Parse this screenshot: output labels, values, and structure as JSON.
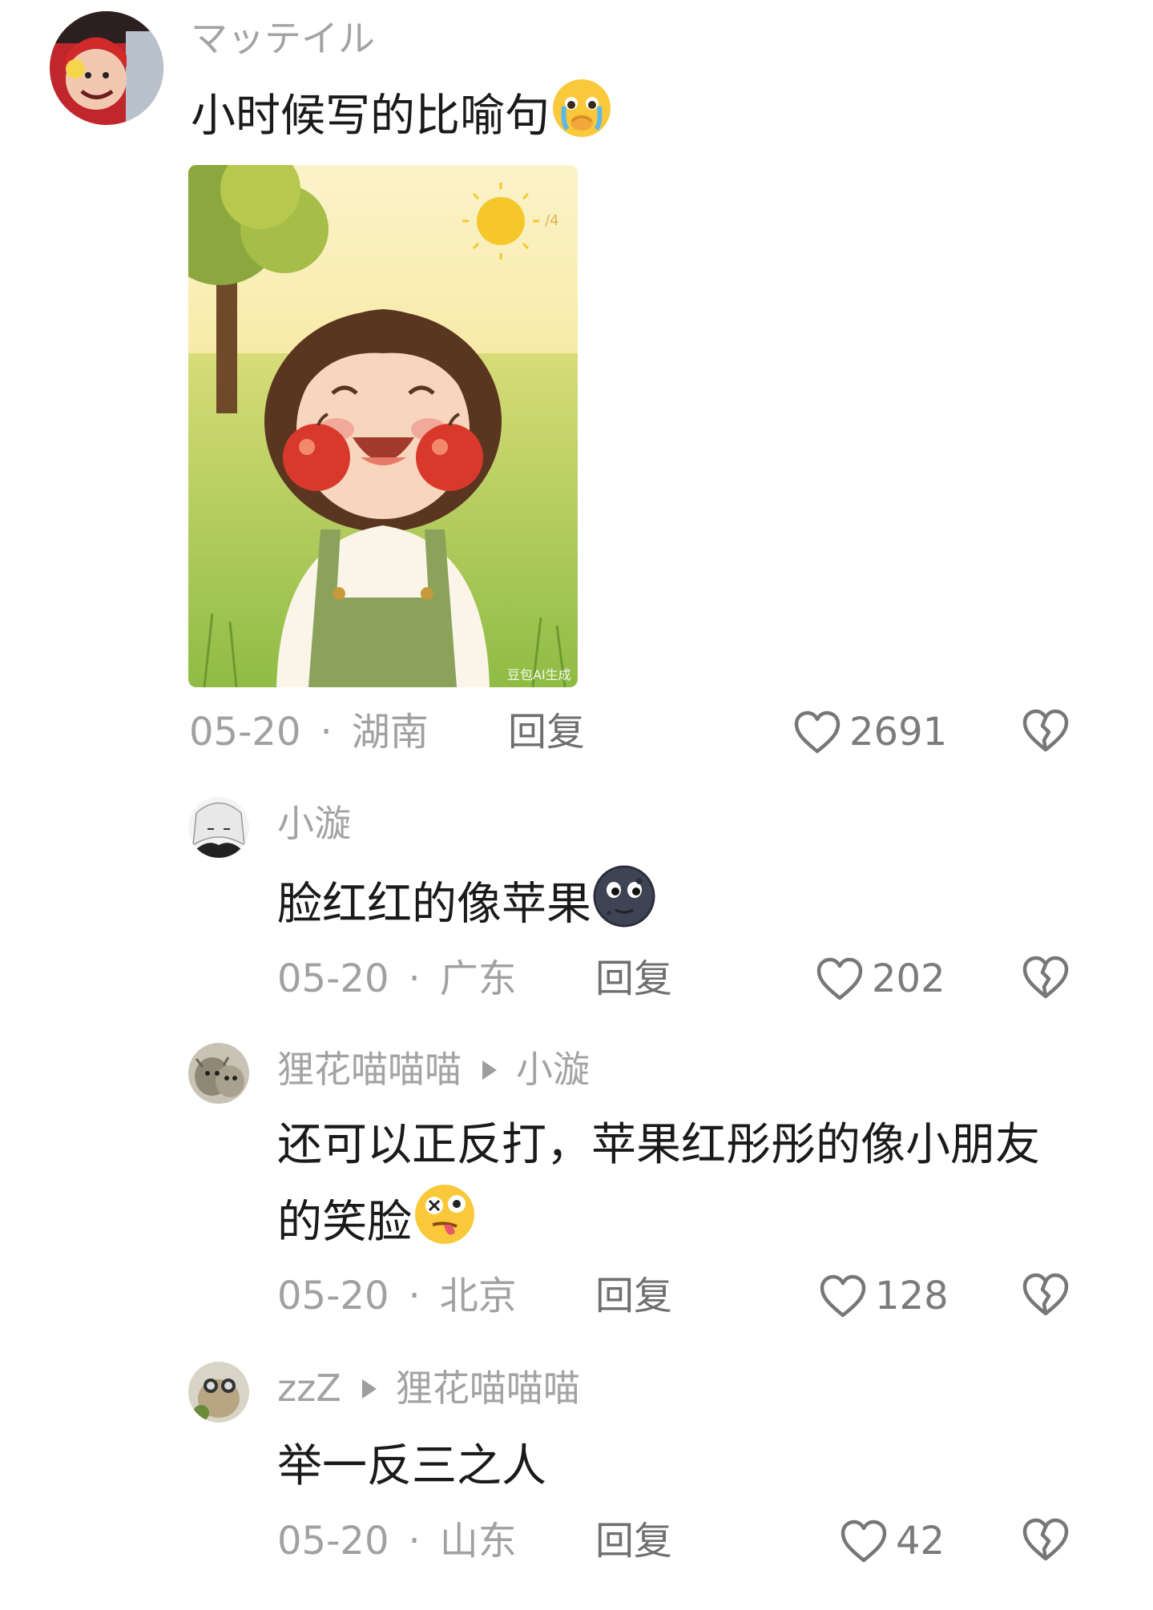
{
  "main_comment": {
    "username": "マッテイル",
    "text": "小时候写的比喻句",
    "emoji_icon": "crying-face-icon",
    "image": {
      "watermark": "豆包AI生成",
      "page_indicator": "/4"
    },
    "date": "05-20",
    "separator": "·",
    "location": "湖南",
    "reply_label": "回复",
    "likes": "2691"
  },
  "replies": [
    {
      "username": "小漩",
      "reply_to": "",
      "text": "脸红红的像苹果",
      "emoji_icon": "dark-moon-face-icon",
      "date": "05-20",
      "separator": "·",
      "location": "广东",
      "reply_label": "回复",
      "likes": "202"
    },
    {
      "username": "狸花喵喵喵",
      "reply_to": "小漩",
      "text_line1": "还可以正反打，苹果红彤彤的像小朋友",
      "text_line2": "的笑脸",
      "emoji_icon": "woozy-tongue-face-icon",
      "date": "05-20",
      "separator": "·",
      "location": "北京",
      "reply_label": "回复",
      "likes": "128"
    },
    {
      "username": "zzZ",
      "reply_to": "狸花喵喵喵",
      "text": "举一反三之人",
      "date": "05-20",
      "separator": "·",
      "location": "山东",
      "reply_label": "回复",
      "likes": "42"
    }
  ],
  "colors": {
    "meta_gray": "#a1a1a1",
    "username_gray": "#a3a3a3",
    "text_dark": "#1a1a1a"
  }
}
